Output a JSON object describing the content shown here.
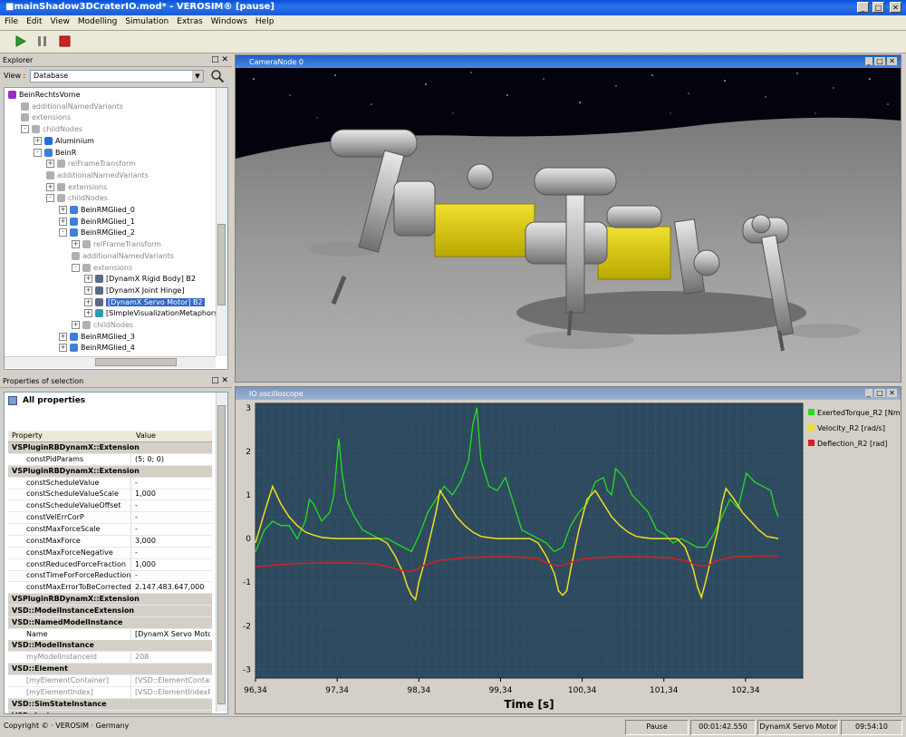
{
  "window": {
    "title": "■mainShadow3DCraterIO.mod* - VEROSIM® [pause]"
  },
  "menu": [
    "File",
    "Edit",
    "View",
    "Modelling",
    "Simulation",
    "Extras",
    "Windows",
    "Help"
  ],
  "toolbar": {
    "icons": [
      "play-icon",
      "pause-icon",
      "stop-icon"
    ],
    "colors": {
      "play": "#2e9c2e",
      "pause": "#7c7c7c",
      "stop": "#d22020"
    }
  },
  "explorer": {
    "title": "Explorer",
    "view_label": "View :",
    "view_value": "Database",
    "tree": [
      {
        "label": "BeinRechtsVorne",
        "indent": 0,
        "style": "normal",
        "icon": "purple"
      },
      {
        "label": "additionalNamedVariants",
        "indent": 1,
        "style": "grey",
        "icon": "var"
      },
      {
        "label": "extensions",
        "indent": 1,
        "style": "grey",
        "icon": "var"
      },
      {
        "label": "childNodes",
        "indent": 1,
        "style": "grey",
        "icon": "var",
        "toggle": "-"
      },
      {
        "label": "Aluminium",
        "indent": 2,
        "style": "normal",
        "icon": "blue",
        "toggle": "+"
      },
      {
        "label": "BeinR",
        "indent": 2,
        "style": "normal",
        "icon": "node",
        "toggle": "-"
      },
      {
        "label": "relFrameTransform",
        "indent": 3,
        "style": "grey",
        "icon": "var",
        "toggle": "+"
      },
      {
        "label": "additionalNamedVariants",
        "indent": 3,
        "style": "grey",
        "icon": "var"
      },
      {
        "label": "extensions",
        "indent": 3,
        "style": "grey",
        "icon": "var",
        "toggle": "+"
      },
      {
        "label": "childNodes",
        "indent": 3,
        "style": "grey",
        "icon": "var",
        "toggle": "-"
      },
      {
        "label": "BeinRMGlied_0",
        "indent": 4,
        "style": "normal",
        "icon": "node",
        "toggle": "+"
      },
      {
        "label": "BeinRMGlied_1",
        "indent": 4,
        "style": "normal",
        "icon": "node",
        "toggle": "+"
      },
      {
        "label": "BeinRMGlied_2",
        "indent": 4,
        "style": "normal",
        "icon": "node",
        "toggle": "-"
      },
      {
        "label": "relFrameTransform",
        "indent": 5,
        "style": "grey",
        "icon": "var",
        "toggle": "+"
      },
      {
        "label": "additionalNamedVariants",
        "indent": 5,
        "style": "grey",
        "icon": "var"
      },
      {
        "label": "extensions",
        "indent": 5,
        "style": "grey",
        "icon": "var",
        "toggle": "-"
      },
      {
        "label": "[DynamX Rigid Body] B2",
        "indent": 6,
        "style": "normal",
        "icon": "ext",
        "toggle": "+"
      },
      {
        "label": "[DynamX Joint Hinge]",
        "indent": 6,
        "style": "normal",
        "icon": "ext",
        "toggle": "+"
      },
      {
        "label": "[DynamX Servo Motor] B2",
        "indent": 6,
        "style": "selected",
        "icon": "ext",
        "toggle": "+"
      },
      {
        "label": "[SimpleVisualizationMetaphors]",
        "indent": 6,
        "style": "normal",
        "icon": "teal",
        "toggle": "+"
      },
      {
        "label": "childNodes",
        "indent": 5,
        "style": "grey",
        "icon": "var",
        "toggle": "+"
      },
      {
        "label": "BeinRMGlied_3",
        "indent": 4,
        "style": "normal",
        "icon": "node",
        "toggle": "+"
      },
      {
        "label": "BeinRMGlied_4",
        "indent": 4,
        "style": "normal",
        "icon": "node",
        "toggle": "+"
      }
    ]
  },
  "properties": {
    "title": "Properties of selection",
    "heading": "All properties",
    "col_property": "Property",
    "col_value": "Value",
    "rows": [
      {
        "kind": "cat",
        "name": "VSPluginRBDynamX::Extension"
      },
      {
        "kind": "row",
        "name": "constPidParams",
        "value": "(5; 0; 0)"
      },
      {
        "kind": "cat",
        "name": "VSPluginRBDynamX::Extension"
      },
      {
        "kind": "row",
        "name": "constScheduleValue",
        "value": "-"
      },
      {
        "kind": "row",
        "name": "constScheduleValueScale",
        "value": "1,000"
      },
      {
        "kind": "row",
        "name": "constScheduleValueOffset",
        "value": "-"
      },
      {
        "kind": "row",
        "name": "constVelErrCorP",
        "value": "-"
      },
      {
        "kind": "row",
        "name": "constMaxForceScale",
        "value": "-"
      },
      {
        "kind": "row",
        "name": "constMaxForce",
        "value": "3,000"
      },
      {
        "kind": "row",
        "name": "constMaxForceNegative",
        "value": "-"
      },
      {
        "kind": "row",
        "name": "constReducedForceFraction",
        "value": "1,000"
      },
      {
        "kind": "row",
        "name": "constTimeForForceReduction",
        "value": "-"
      },
      {
        "kind": "row",
        "name": "constMaxErrorToBeCorrected",
        "value": "2.147.483.647,000"
      },
      {
        "kind": "cat",
        "name": "VSPluginRBDynamX::Extension"
      },
      {
        "kind": "cat",
        "name": "VSD::ModelInstanceExtension"
      },
      {
        "kind": "cat",
        "name": "VSD::NamedModelInstance"
      },
      {
        "kind": "row",
        "name": "Name",
        "value": "[DynamX Servo Motor"
      },
      {
        "kind": "cat",
        "name": "VSD::ModelInstance"
      },
      {
        "kind": "grey",
        "name": "myModelInstanceId",
        "value": "208"
      },
      {
        "kind": "cat",
        "name": "VSD::Element"
      },
      {
        "kind": "grey",
        "name": "[myElementContainer]",
        "value": "[VSD::ElementContain"
      },
      {
        "kind": "grey",
        "name": "[myElementIndex]",
        "value": "[VSD::ElementIndexPt"
      },
      {
        "kind": "cat",
        "name": "VSD::SimStateInstance"
      },
      {
        "kind": "cat",
        "name": "VSD::Instance"
      }
    ]
  },
  "camera": {
    "title": "CameraNode 0"
  },
  "oscilloscope": {
    "title": "IO oscilloscope"
  },
  "chart_data": {
    "type": "line",
    "xlabel": "Time [s]",
    "ylabel": "",
    "x_ticks": [
      "96,34",
      "97,34",
      "98,34",
      "99,34",
      "100,34",
      "101,34",
      "102,34"
    ],
    "y_ticks": [
      "3",
      "2",
      "1",
      "0",
      "-1",
      "-2",
      "-3"
    ],
    "xlim": [
      96.34,
      103.04
    ],
    "ylim": [
      -3.2,
      3.1
    ],
    "grid": true,
    "legend_position": "right",
    "series": [
      {
        "name": "ExertedTorque_R2 [Nm]",
        "color": "#22dd22",
        "x": [
          96.34,
          96.45,
          96.55,
          96.65,
          96.75,
          96.85,
          96.95,
          97.0,
          97.05,
          97.15,
          97.25,
          97.3,
          97.36,
          97.4,
          97.45,
          97.55,
          97.65,
          97.75,
          97.85,
          97.95,
          98.05,
          98.15,
          98.25,
          98.35,
          98.45,
          98.55,
          98.65,
          98.75,
          98.85,
          98.95,
          99.0,
          99.05,
          99.1,
          99.15,
          99.2,
          99.3,
          99.4,
          99.5,
          99.6,
          99.7,
          99.8,
          99.9,
          100.0,
          100.1,
          100.2,
          100.3,
          100.4,
          100.5,
          100.6,
          100.65,
          100.7,
          100.75,
          100.85,
          100.95,
          101.05,
          101.15,
          101.25,
          101.35,
          101.45,
          101.55,
          101.65,
          101.75,
          101.85,
          101.95,
          102.05,
          102.15,
          102.25,
          102.35,
          102.45,
          102.55,
          102.65,
          102.7,
          102.74
        ],
        "y": [
          -0.3,
          0.2,
          0.4,
          0.3,
          0.3,
          0.0,
          0.4,
          0.9,
          0.8,
          0.4,
          0.6,
          1.0,
          2.3,
          1.5,
          0.9,
          0.5,
          0.2,
          0.1,
          0.0,
          0.0,
          -0.1,
          -0.2,
          -0.3,
          0.1,
          0.6,
          0.9,
          1.2,
          1.0,
          1.3,
          1.8,
          2.6,
          3.0,
          1.8,
          1.5,
          1.2,
          1.1,
          1.4,
          0.8,
          0.2,
          0.1,
          0.0,
          -0.1,
          -0.3,
          -0.2,
          0.3,
          0.6,
          0.8,
          1.3,
          1.4,
          1.1,
          1.0,
          1.6,
          1.4,
          1.0,
          0.8,
          0.6,
          0.2,
          0.1,
          -0.1,
          0.0,
          -0.1,
          -0.2,
          -0.2,
          0.1,
          0.5,
          0.9,
          0.7,
          1.5,
          1.3,
          1.2,
          1.1,
          0.7,
          0.5
        ]
      },
      {
        "name": "Velocity_R2 [rad/s]",
        "color": "#f0e020",
        "x": [
          96.34,
          96.45,
          96.55,
          96.65,
          96.75,
          96.85,
          96.95,
          97.05,
          97.15,
          97.25,
          97.35,
          97.45,
          97.55,
          97.65,
          97.75,
          97.85,
          97.95,
          98.05,
          98.15,
          98.2,
          98.25,
          98.3,
          98.34,
          98.4,
          98.5,
          98.55,
          98.6,
          98.7,
          98.8,
          98.9,
          99.0,
          99.1,
          99.2,
          99.3,
          99.4,
          99.5,
          99.6,
          99.7,
          99.8,
          99.9,
          100.0,
          100.05,
          100.1,
          100.15,
          100.2,
          100.3,
          100.4,
          100.5,
          100.6,
          100.7,
          100.8,
          100.9,
          101.0,
          101.1,
          101.2,
          101.3,
          101.4,
          101.5,
          101.6,
          101.7,
          101.75,
          101.8,
          101.85,
          101.9,
          102.0,
          102.05,
          102.1,
          102.2,
          102.3,
          102.4,
          102.5,
          102.6,
          102.74
        ],
        "y": [
          -0.1,
          0.6,
          1.2,
          0.8,
          0.5,
          0.3,
          0.15,
          0.08,
          0.03,
          0.01,
          0.0,
          0.0,
          0.0,
          0.0,
          0.0,
          0.0,
          -0.1,
          -0.4,
          -0.8,
          -1.1,
          -1.3,
          -1.4,
          -1.0,
          -0.6,
          0.2,
          0.6,
          1.1,
          0.8,
          0.5,
          0.3,
          0.15,
          0.05,
          0.02,
          0.0,
          0.0,
          0.0,
          0.0,
          0.0,
          -0.1,
          -0.4,
          -0.8,
          -1.2,
          -1.3,
          -1.2,
          -0.7,
          0.2,
          0.9,
          1.1,
          0.8,
          0.5,
          0.3,
          0.15,
          0.05,
          0.02,
          0.0,
          0.0,
          0.0,
          0.0,
          -0.2,
          -0.7,
          -1.1,
          -1.35,
          -1.0,
          -0.6,
          0.2,
          0.8,
          1.15,
          0.9,
          0.6,
          0.4,
          0.2,
          0.05,
          0.0
        ]
      },
      {
        "name": "Deflection_R2 [rad]",
        "color": "#d42020",
        "x": [
          96.34,
          96.6,
          96.9,
          97.2,
          97.5,
          97.8,
          98.0,
          98.1,
          98.2,
          98.3,
          98.4,
          98.6,
          98.9,
          99.2,
          99.5,
          99.8,
          99.9,
          100.0,
          100.1,
          100.2,
          100.3,
          100.5,
          100.8,
          101.1,
          101.4,
          101.6,
          101.7,
          101.8,
          101.9,
          102.0,
          102.2,
          102.5,
          102.74
        ],
        "y": [
          -0.65,
          -0.6,
          -0.57,
          -0.56,
          -0.56,
          -0.58,
          -0.66,
          -0.72,
          -0.76,
          -0.72,
          -0.62,
          -0.5,
          -0.44,
          -0.42,
          -0.42,
          -0.46,
          -0.55,
          -0.62,
          -0.62,
          -0.55,
          -0.48,
          -0.44,
          -0.42,
          -0.42,
          -0.44,
          -0.5,
          -0.58,
          -0.64,
          -0.6,
          -0.5,
          -0.42,
          -0.4,
          -0.4
        ]
      }
    ]
  },
  "status": {
    "copyright": "Copyright © · VEROSIM · Germany",
    "state": "Pause",
    "elapsed": "00:01:42.550",
    "selection": "DynamX Servo Motor",
    "clock": "09:54:10"
  }
}
